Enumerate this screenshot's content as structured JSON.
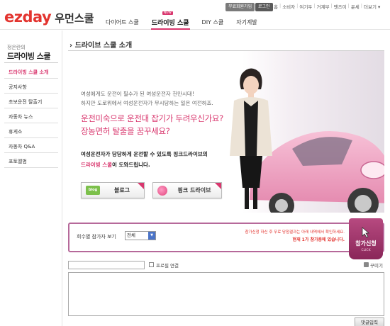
{
  "header": {
    "logo_brand": "ezday",
    "logo_sub": "우먼스쿨",
    "util_join": "무료회원가입",
    "util_login": "로그인",
    "util_links": [
      "홈",
      "소비자",
      "여기우",
      "거계부",
      "맨즈이",
      "운세",
      "더보기 ▾"
    ],
    "nav": [
      {
        "label": "다이어트 스쿨",
        "active": false
      },
      {
        "label": "드라이빙 스쿨",
        "active": true
      },
      {
        "label": "DIY 스쿨",
        "active": false
      },
      {
        "label": "자기계발",
        "active": false
      }
    ],
    "nav_badge": "NEW"
  },
  "sidebar": {
    "heading_sub": "정은란의",
    "heading": "드라이빙 스쿨",
    "items": [
      {
        "label": "드라이빙 스쿨 소개",
        "active": true
      },
      {
        "label": "공지사항",
        "active": false
      },
      {
        "label": "초보운전 탈출기",
        "active": false
      },
      {
        "label": "자동차 뉴스",
        "active": false
      },
      {
        "label": "휴게소",
        "active": false
      },
      {
        "label": "자동차 Q&A",
        "active": false
      },
      {
        "label": "포토앨범",
        "active": false
      }
    ]
  },
  "main": {
    "page_title": "드라이브 스쿨 소개",
    "hero": {
      "intro_line1": "여성에게도 운전이 필수가 된 여성운전자 천만시대!",
      "intro_line2": "하지만 도로위에서 여성운전자가 무시당하는 일은 여전하죠.",
      "question_line1": "운전미숙으로 운전대 잡기가 두려우신가요?",
      "question_line2": "장농면허 탈출을 꿈꾸세요?",
      "desc_line1": "여성운전자가 당당하게 운전할 수 있도록 핑크드라이브의",
      "desc_highlight": "드라이빙 스쿨",
      "desc_line2_rest": "이 도와드립니다.",
      "btn_blog_badge": "blog",
      "btn_blog_label": "블로그",
      "btn_pink_label": "핑크 드라이브"
    },
    "participants": {
      "label": "회수별 참가자 보기",
      "select_value": "전체",
      "note1": "참가신청 하신 후 무료 당첨결과는 아래 내역에서 확인하세요.",
      "note2": "현재 1가 참가중에 있습니다.",
      "apply_label": "참가신청",
      "apply_sub": "CLICK"
    },
    "comment": {
      "profile_label": "프로필 연결",
      "decorate_label": "꾸미기",
      "submit_label": "댓글입력"
    }
  },
  "colors": {
    "brand_red": "#e3342f",
    "accent_pink": "#d9376e",
    "apply_purple": "#8a2659",
    "car_pink": "#f0a6c4"
  }
}
